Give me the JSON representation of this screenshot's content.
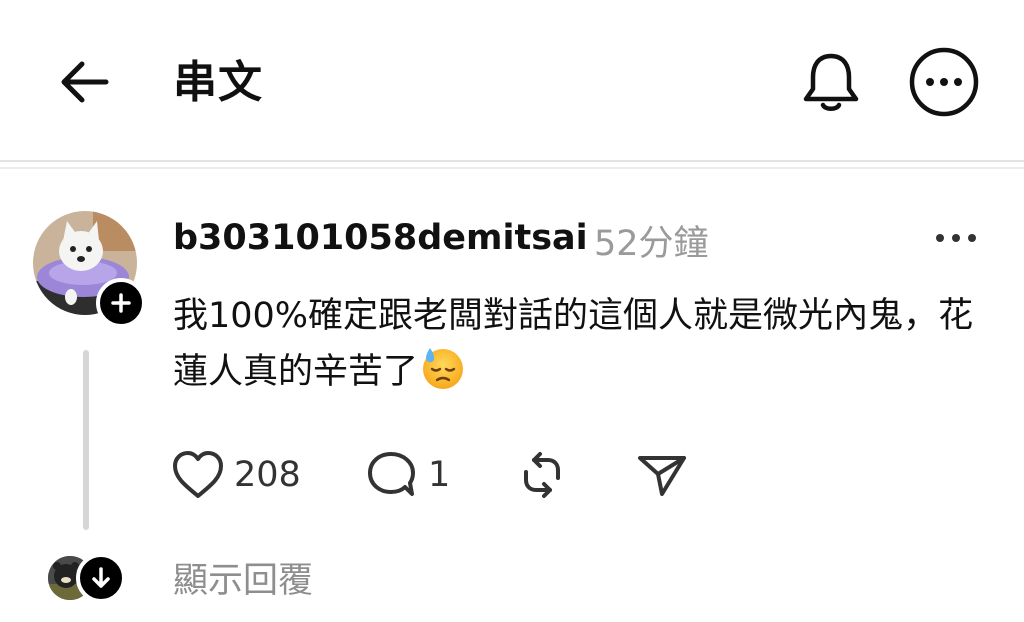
{
  "header": {
    "title": "串文"
  },
  "post": {
    "username": "b303101058demitsai",
    "timestamp": "52分鐘",
    "text": "我100%確定跟老闆對話的這個人就是微光內鬼，花蓮人真的辛苦了",
    "emoji": "downcast-face-with-sweat",
    "likes": "208",
    "comments": "1"
  },
  "replies": {
    "show_label": "顯示回覆"
  },
  "icons": {
    "back": "arrow-left-icon",
    "notifications": "bell-icon",
    "more": "more-circle-icon",
    "like": "heart-icon",
    "comment": "comment-icon",
    "repost": "repost-icon",
    "share": "send-icon"
  }
}
